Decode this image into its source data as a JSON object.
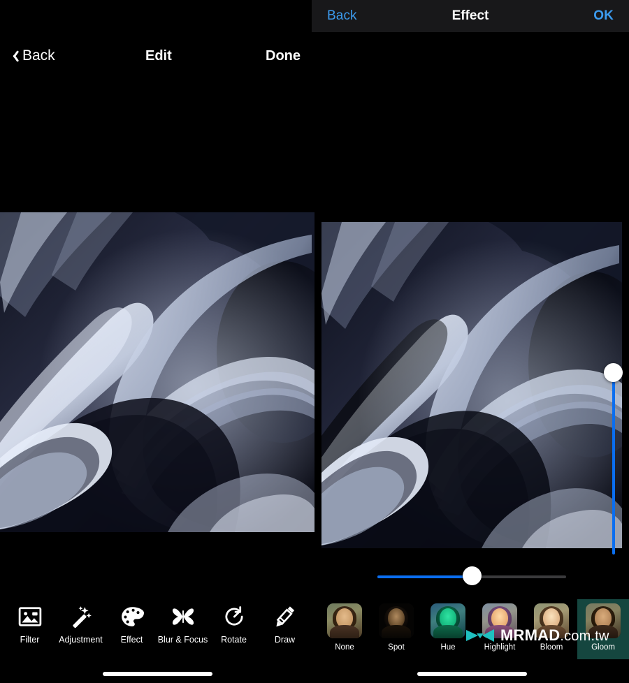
{
  "effect_bar": {
    "back_label": "Back",
    "title": "Effect",
    "ok_label": "OK",
    "accent_color": "#3c9cf0",
    "background_color": "#18181a"
  },
  "edit_bar": {
    "back_label": "Back",
    "title": "Edit",
    "done_label": "Done"
  },
  "preview": {
    "left_image_name": "abstract-blue-wave-original",
    "right_image_name": "abstract-blue-wave-edited"
  },
  "vertical_slider": {
    "name": "effect-intensity-vertical-slider",
    "value_percent": 10,
    "fill_color": "#0a6ef0",
    "knob_color": "#ffffff"
  },
  "horizontal_slider": {
    "name": "effect-amount-slider",
    "value_percent": 50,
    "fill_color": "#0a6ef0",
    "track_color": "#3a3a3c",
    "knob_color": "#ffffff"
  },
  "tools": [
    {
      "id": "filter",
      "label": "Filter",
      "icon": "photo-icon"
    },
    {
      "id": "adjustment",
      "label": "Adjustment",
      "icon": "magic-wand-icon"
    },
    {
      "id": "effect",
      "label": "Effect",
      "icon": "palette-icon"
    },
    {
      "id": "blur-focus",
      "label": "Blur & Focus",
      "icon": "butterfly-icon"
    },
    {
      "id": "rotate",
      "label": "Rotate",
      "icon": "rotate-icon"
    },
    {
      "id": "draw",
      "label": "Draw",
      "icon": "pencil-icon"
    }
  ],
  "effects": [
    {
      "id": "none",
      "label": "None",
      "selected": false
    },
    {
      "id": "spot",
      "label": "Spot",
      "selected": false
    },
    {
      "id": "hue",
      "label": "Hue",
      "selected": false
    },
    {
      "id": "highlight",
      "label": "Highlight",
      "selected": false
    },
    {
      "id": "bloom",
      "label": "Bloom",
      "selected": false
    },
    {
      "id": "gloom",
      "label": "Gloom",
      "selected": true
    }
  ],
  "selection_highlight_color": "#15463f",
  "watermark": {
    "brand": "MRMAD",
    "domain": ".com.tw",
    "logo_color": "#1bb8b8"
  }
}
